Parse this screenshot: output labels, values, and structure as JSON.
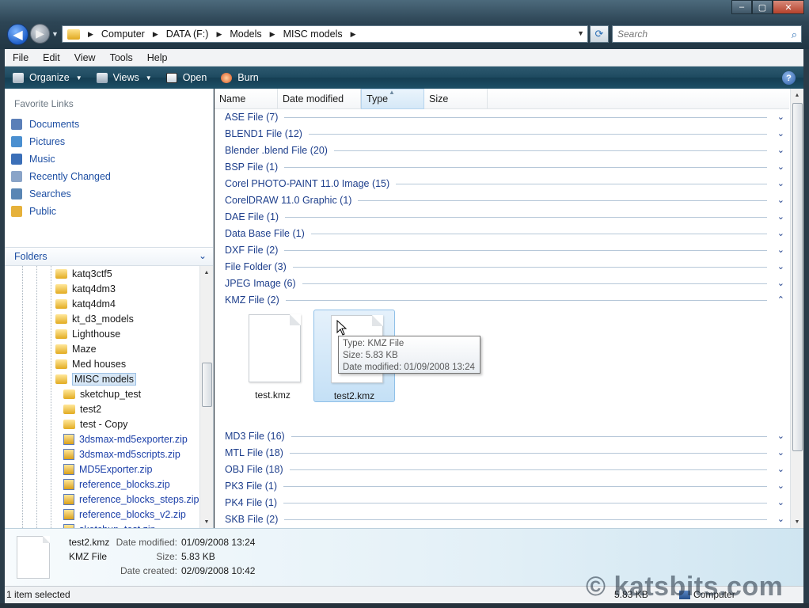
{
  "window": {
    "minimize_glyph": "‒",
    "maximize_glyph": "▢",
    "close_glyph": "✕"
  },
  "address": {
    "crumbs": [
      "Computer",
      "DATA (F:)",
      "Models",
      "MISC models"
    ],
    "search_placeholder": "Search"
  },
  "menu": [
    "File",
    "Edit",
    "View",
    "Tools",
    "Help"
  ],
  "toolbar": {
    "organize": "Organize",
    "views": "Views",
    "open": "Open",
    "burn": "Burn",
    "help": "?"
  },
  "favorites": {
    "title": "Favorite Links",
    "items": [
      {
        "label": "Documents",
        "color": "#5b7fb8"
      },
      {
        "label": "Pictures",
        "color": "#4a8fd0"
      },
      {
        "label": "Music",
        "color": "#3b6fb8"
      },
      {
        "label": "Recently Changed",
        "color": "#8aa4c8"
      },
      {
        "label": "Searches",
        "color": "#5a86b4"
      },
      {
        "label": "Public",
        "color": "#e6b13a"
      }
    ]
  },
  "folders": {
    "title": "Folders",
    "items": [
      {
        "label": "katq3ctf5",
        "kind": "folder",
        "level": 1
      },
      {
        "label": "katq4dm3",
        "kind": "folder",
        "level": 1
      },
      {
        "label": "katq4dm4",
        "kind": "folder",
        "level": 1
      },
      {
        "label": "kt_d3_models",
        "kind": "folder",
        "level": 1
      },
      {
        "label": "Lighthouse",
        "kind": "folder",
        "level": 1
      },
      {
        "label": "Maze",
        "kind": "folder",
        "level": 1
      },
      {
        "label": "Med houses",
        "kind": "folder",
        "level": 1
      },
      {
        "label": "MISC models",
        "kind": "folder",
        "level": 1,
        "selected": true
      },
      {
        "label": "sketchup_test",
        "kind": "folder",
        "level": 2
      },
      {
        "label": "test2",
        "kind": "folder",
        "level": 2
      },
      {
        "label": "test - Copy",
        "kind": "folder",
        "level": 2
      },
      {
        "label": "3dsmax-md5exporter.zip",
        "kind": "zip",
        "level": 2
      },
      {
        "label": "3dsmax-md5scripts.zip",
        "kind": "zip",
        "level": 2
      },
      {
        "label": "MD5Exporter.zip",
        "kind": "zip",
        "level": 2
      },
      {
        "label": "reference_blocks.zip",
        "kind": "zip",
        "level": 2
      },
      {
        "label": "reference_blocks_steps.zip",
        "kind": "zip",
        "level": 2
      },
      {
        "label": "reference_blocks_v2.zip",
        "kind": "zip",
        "level": 2
      },
      {
        "label": "sketchup_test.zip",
        "kind": "zip",
        "level": 2
      }
    ]
  },
  "columns": [
    "Name",
    "Date modified",
    "Type",
    "Size"
  ],
  "groups_top": [
    "ASE File (7)",
    "BLEND1 File (12)",
    "Blender .blend File (20)",
    "BSP File (1)",
    "Corel PHOTO-PAINT 11.0 Image (15)",
    "CorelDRAW 11.0 Graphic (1)",
    "DAE File (1)",
    "Data Base File (1)",
    "DXF File (2)",
    "File Folder (3)",
    "JPEG Image (6)",
    "KMZ File (2)"
  ],
  "groups_bottom": [
    "MD3 File (16)",
    "MTL File (18)",
    "OBJ File (18)",
    "PK3 File (1)",
    "PK4 File (1)",
    "SKB File (2)"
  ],
  "chevron_down": "⌄",
  "chevron_up": "⌃",
  "files": [
    {
      "name": "test.kmz",
      "selected": false
    },
    {
      "name": "test2.kmz",
      "selected": true
    }
  ],
  "tooltip": {
    "type": "Type: KMZ File",
    "size": "Size: 5.83 KB",
    "modified": "Date modified: 01/09/2008 13:24"
  },
  "details": {
    "filename": "test2.kmz",
    "filetype": "KMZ File",
    "modified_label": "Date modified:",
    "modified_value": "01/09/2008 13:24",
    "size_label": "Size:",
    "size_value": "5.83 KB",
    "created_label": "Date created:",
    "created_value": "02/09/2008 10:42"
  },
  "status": {
    "selection": "1 item selected",
    "size": "5.83 KB",
    "location": "Computer"
  },
  "watermark": "© katsbits.com"
}
